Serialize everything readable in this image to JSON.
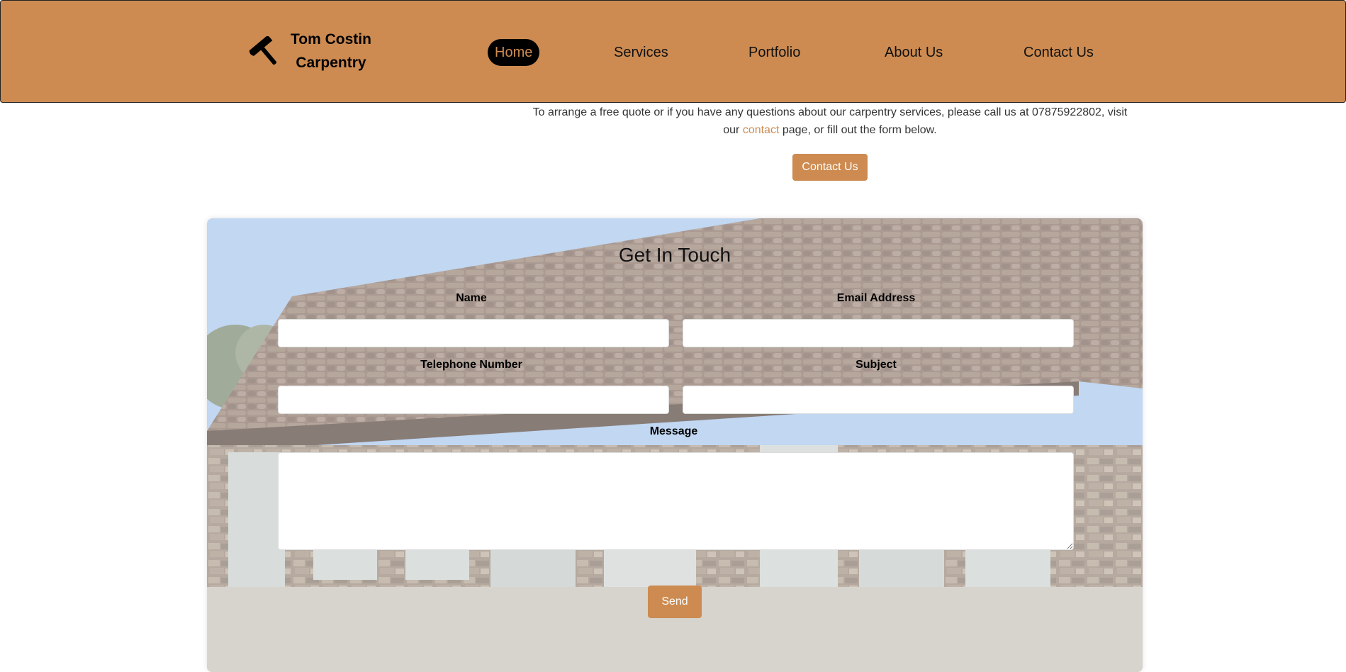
{
  "header": {
    "brand_line1": "Tom Costin",
    "brand_line2": "Carpentry",
    "logo_icon": "hammer-icon",
    "nav": [
      "Home",
      "Services",
      "Portfolio",
      "About Us",
      "Contact Us"
    ],
    "active_nav": "Home"
  },
  "intro": {
    "text_before": "To arrange a free quote or if you have any questions about our carpentry services, please call us at 07875922802, visit our ",
    "link_text": "contact",
    "text_after": " page, or fill out the form below.",
    "button_label": "Contact Us"
  },
  "form": {
    "title": "Get In Touch",
    "name_label": "Name",
    "email_label": "Email Address",
    "phone_label": "Telephone Number",
    "subject_label": "Subject",
    "message_label": "Message",
    "name_value": "",
    "email_value": "",
    "phone_value": "",
    "subject_value": "",
    "message_value": "",
    "send_label": "Send"
  },
  "colors": {
    "accent": "#cd8b51",
    "nav_active_bg": "#000000",
    "text": "#222222"
  }
}
